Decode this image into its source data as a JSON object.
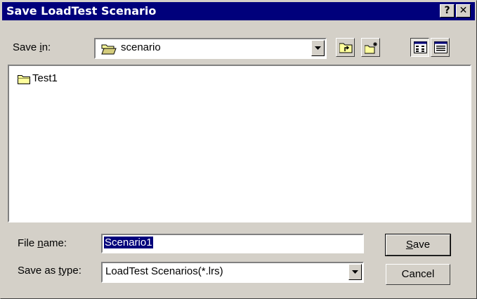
{
  "window": {
    "title": "Save LoadTest Scenario",
    "help_glyph": "?",
    "close_glyph": "✕"
  },
  "save_in": {
    "label_pre": "Save ",
    "label_ul": "i",
    "label_post": "n:",
    "value": "scenario",
    "folder_icon": "open-folder-icon"
  },
  "toolbar": {
    "up_icon": "up-one-level-icon",
    "new_folder_icon": "create-new-folder-icon",
    "list_icon": "list-view-icon",
    "details_icon": "details-view-icon"
  },
  "files": [
    {
      "name": "Test1",
      "icon": "folder-icon"
    }
  ],
  "file_name": {
    "label_pre": "File ",
    "label_ul": "n",
    "label_post": "ame:",
    "value": "Scenario1"
  },
  "save_as_type": {
    "label_pre": "Save as ",
    "label_ul": "t",
    "label_post": "ype:",
    "value": "LoadTest Scenarios(*.lrs)"
  },
  "buttons": {
    "save_ul": "S",
    "save_rest": "ave",
    "cancel": "Cancel"
  },
  "colors": {
    "titlebar": "#00007b",
    "face": "#d4d0c8",
    "selection": "#00007b",
    "folder_yellow": "#ffff9c"
  }
}
